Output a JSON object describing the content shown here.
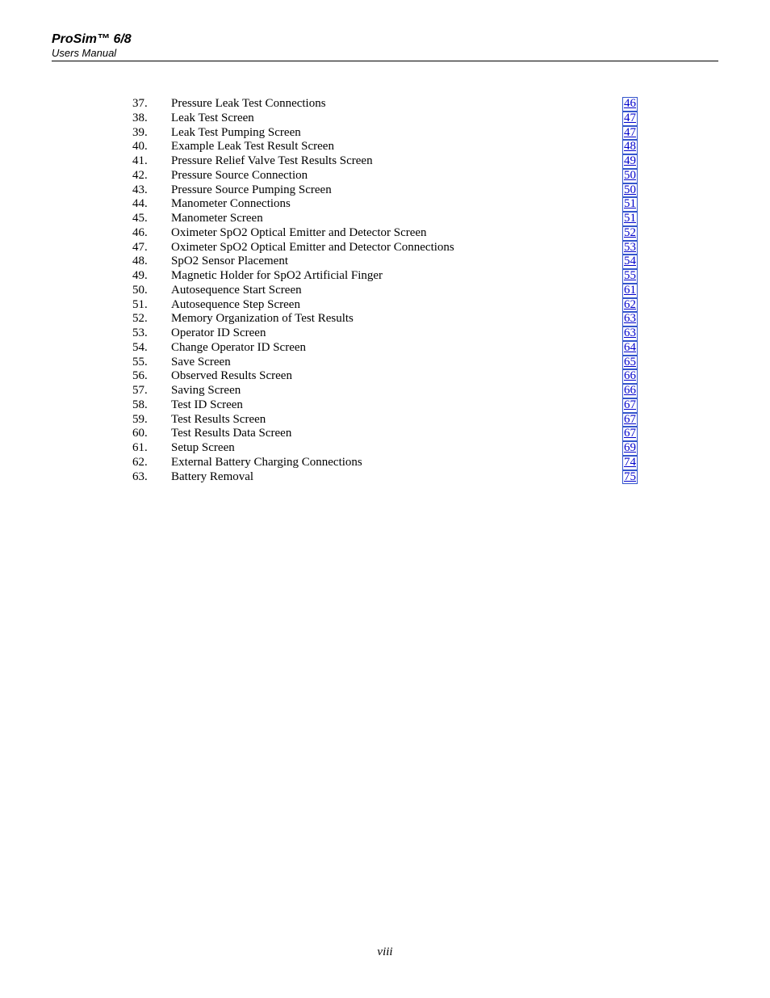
{
  "header": {
    "title": "ProSim™ 6/8",
    "subtitle": "Users Manual"
  },
  "toc": {
    "entries": [
      {
        "num": "37.",
        "title": "Pressure Leak Test Connections",
        "page": "46"
      },
      {
        "num": "38.",
        "title": "Leak Test Screen",
        "page": "47"
      },
      {
        "num": "39.",
        "title": "Leak Test Pumping Screen",
        "page": "47"
      },
      {
        "num": "40.",
        "title": "Example Leak Test Result Screen",
        "page": "48"
      },
      {
        "num": "41.",
        "title": "Pressure Relief Valve Test Results Screen",
        "page": "49"
      },
      {
        "num": "42.",
        "title": "Pressure Source Connection",
        "page": "50"
      },
      {
        "num": "43.",
        "title": "Pressure Source Pumping Screen",
        "page": "50"
      },
      {
        "num": "44.",
        "title": "Manometer Connections",
        "page": "51"
      },
      {
        "num": "45.",
        "title": "Manometer Screen",
        "page": "51"
      },
      {
        "num": "46.",
        "title": "Oximeter SpO2 Optical Emitter and Detector Screen",
        "page": "52"
      },
      {
        "num": "47.",
        "title": "Oximeter SpO2 Optical Emitter and Detector Connections",
        "page": "53"
      },
      {
        "num": "48.",
        "title": "SpO2 Sensor Placement",
        "page": "54"
      },
      {
        "num": "49.",
        "title": "Magnetic Holder for SpO2 Artificial Finger",
        "page": "55"
      },
      {
        "num": "50.",
        "title": "Autosequence Start Screen",
        "page": "61"
      },
      {
        "num": "51.",
        "title": "Autosequence Step Screen",
        "page": "62"
      },
      {
        "num": "52.",
        "title": "Memory Organization of Test Results",
        "page": "63"
      },
      {
        "num": "53.",
        "title": "Operator ID Screen",
        "page": "63"
      },
      {
        "num": "54.",
        "title": "Change Operator ID Screen",
        "page": "64"
      },
      {
        "num": "55.",
        "title": "Save Screen",
        "page": "65"
      },
      {
        "num": "56.",
        "title": "Observed Results Screen",
        "page": "66"
      },
      {
        "num": "57.",
        "title": "Saving Screen",
        "page": "66"
      },
      {
        "num": "58.",
        "title": "Test ID Screen",
        "page": "67"
      },
      {
        "num": "59.",
        "title": "Test Results Screen",
        "page": "67"
      },
      {
        "num": "60.",
        "title": "Test Results Data Screen",
        "page": "67"
      },
      {
        "num": "61.",
        "title": "Setup Screen",
        "page": "69"
      },
      {
        "num": "62.",
        "title": "External Battery Charging Connections",
        "page": "74"
      },
      {
        "num": "63.",
        "title": "Battery Removal",
        "page": "75"
      }
    ]
  },
  "page_number": "viii"
}
